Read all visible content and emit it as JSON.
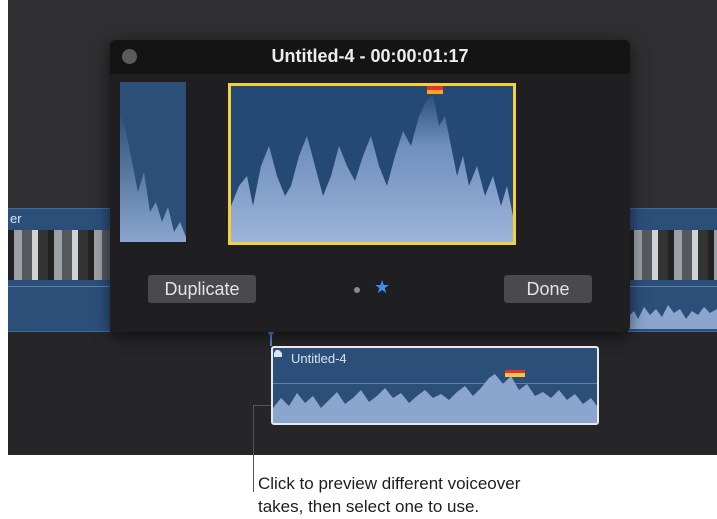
{
  "popover": {
    "title": "Untitled-4 - 00:00:01:17",
    "duplicate_label": "Duplicate",
    "done_label": "Done",
    "pager_star": "★"
  },
  "timeline": {
    "left_clip_label": "er",
    "voice_clip_label": "Untitled-4"
  },
  "callout": {
    "line1": "Click to preview different voiceover",
    "line2": "takes, then select one to use."
  },
  "colors": {
    "selection_border": "#f2d13c",
    "audio_clip": "#2c4f7a",
    "waveform": "#8aa6cf",
    "peak_red": "#e8312b",
    "accent_blue": "#3d8ef3"
  }
}
